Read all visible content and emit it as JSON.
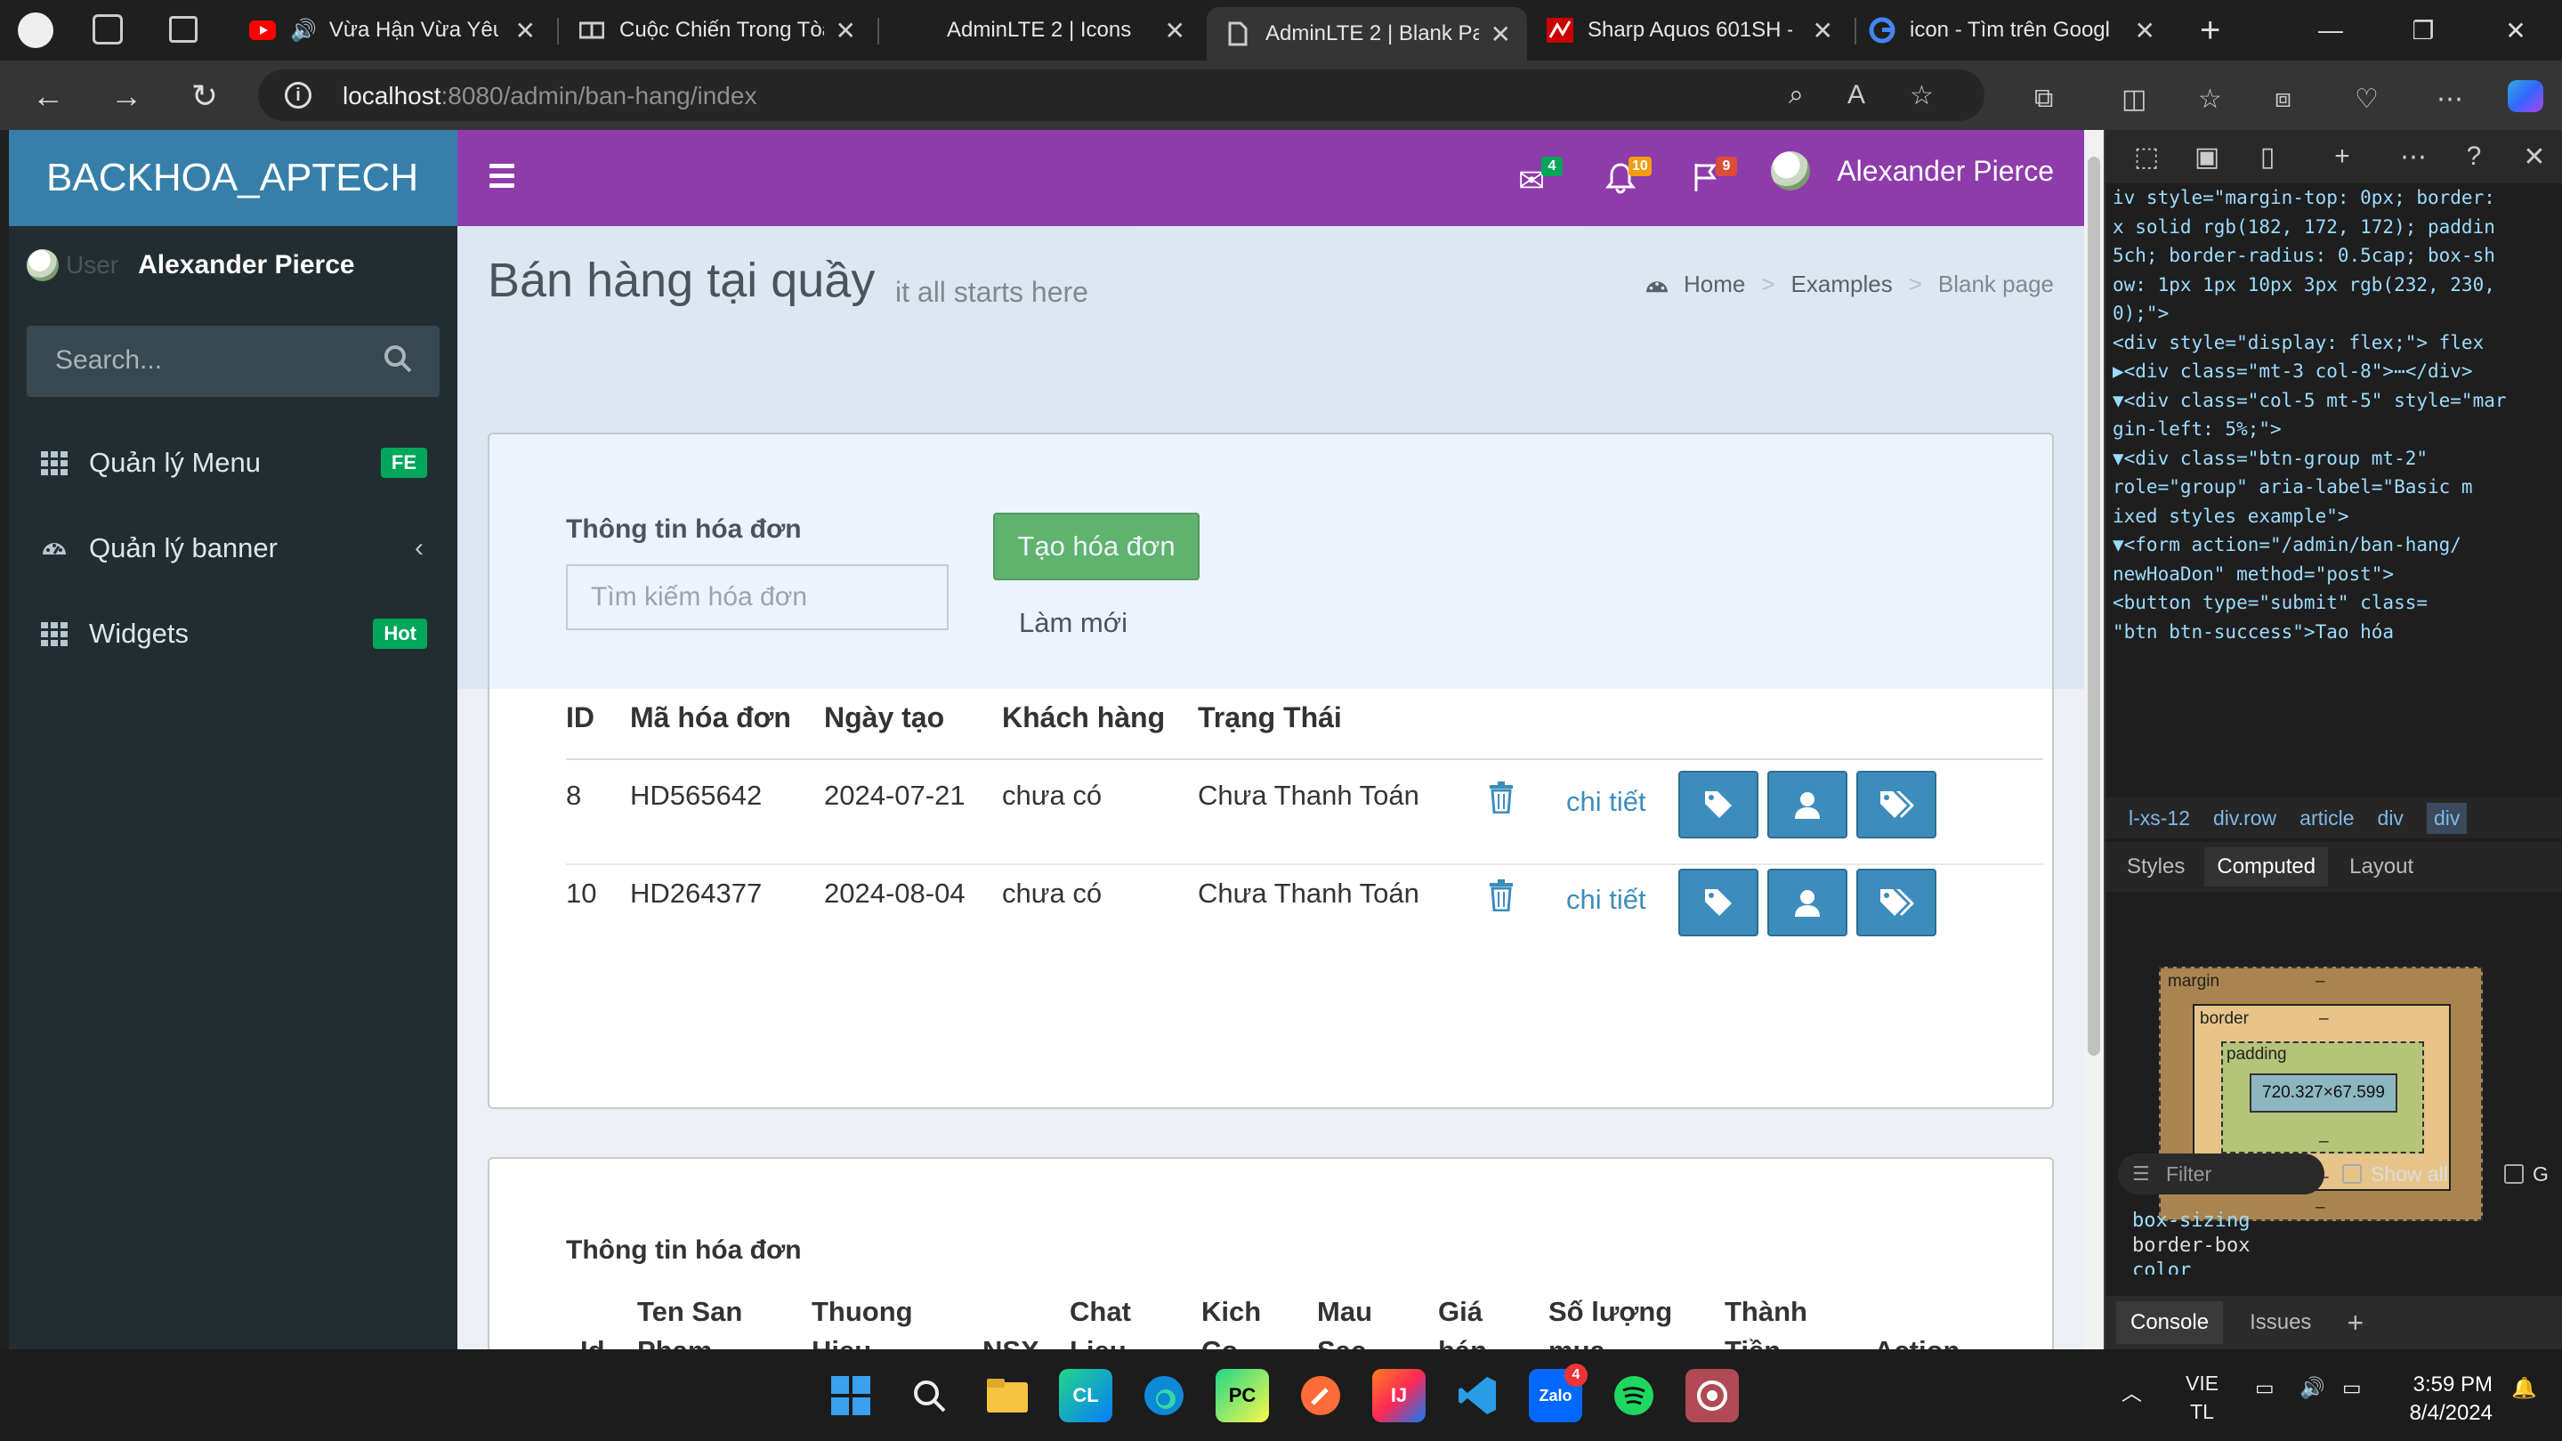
{
  "browser": {
    "tabs": [
      {
        "title": "Vừa Hận Vừa Yêu",
        "favicon": "youtube-icon"
      },
      {
        "title": "Cuộc Chiến Trong Tòa",
        "favicon": "book-icon"
      },
      {
        "title": "AdminLTE 2 | Icons",
        "favicon": "none"
      },
      {
        "title": "AdminLTE 2 | Blank Pa",
        "favicon": "page-icon"
      },
      {
        "title": "Sharp Aquos 601SH -",
        "favicon": "store-icon"
      },
      {
        "title": "icon - Tìm trên Googl",
        "favicon": "google-icon"
      }
    ],
    "url_host": "localhost",
    "url_path": ":8080/admin/ban-hang/index"
  },
  "app": {
    "logo": "BACKHOA_APTECH",
    "user_name": "Alexander Pierce",
    "notifications": {
      "messages": "4",
      "alerts": "10",
      "tasks": "9"
    }
  },
  "sidebar": {
    "user_name": "Alexander Pierce",
    "user_alt": "User",
    "search_placeholder": "Search...",
    "items": [
      {
        "label": "Quản lý Menu",
        "badge": "FE"
      },
      {
        "label": "Quản lý banner",
        "badge": ""
      },
      {
        "label": "Widgets",
        "badge": "Hot"
      }
    ]
  },
  "header": {
    "title": "Bán hàng tại quầy",
    "subtitle": "it all starts here",
    "breadcrumb": [
      "Home",
      "Examples",
      "Blank page"
    ]
  },
  "invoice_box": {
    "section_title": "Thông tin hóa đơn",
    "search_placeholder": "Tìm kiếm hóa đơn",
    "create_label": "Tạo hóa đơn",
    "refresh_label": "Làm mới",
    "columns": [
      "ID",
      "Mã hóa đơn",
      "Ngày tạo",
      "Khách hàng",
      "Trạng Thái"
    ],
    "detail_label": "chi tiết",
    "rows": [
      {
        "id": "8",
        "code": "HD565642",
        "date": "2024-07-21",
        "customer": "chưa có",
        "status": "Chưa Thanh Toán"
      },
      {
        "id": "10",
        "code": "HD264377",
        "date": "2024-08-04",
        "customer": "chưa có",
        "status": "Chưa Thanh Toán"
      }
    ]
  },
  "detail_box": {
    "section_title": "Thông tin hóa đơn",
    "columns": [
      {
        "l1": "",
        "l2": "Id"
      },
      {
        "l1": "Ten San",
        "l2": "Pham"
      },
      {
        "l1": "Thuong",
        "l2": "Hieu"
      },
      {
        "l1": "",
        "l2": "NSX"
      },
      {
        "l1": "Chat",
        "l2": "Lieu"
      },
      {
        "l1": "Kich",
        "l2": "Co"
      },
      {
        "l1": "Mau",
        "l2": "Sac"
      },
      {
        "l1": "Giá",
        "l2": "bán"
      },
      {
        "l1": "Số lượng",
        "l2": "mua"
      },
      {
        "l1": "Thành",
        "l2": "Tiền"
      },
      {
        "l1": "",
        "l2": "Action"
      }
    ]
  },
  "devtools": {
    "dom_lines": [
      "iv style=\"margin-top: 0px; border:",
      "x solid rgb(182, 172, 172); paddin",
      " 5ch; border-radius: 0.5cap; box-sh",
      "ow: 1px 1px 10px 3px rgb(232, 230,",
      "0);\">",
      "<div style=\"display: flex;\"> flex",
      "▶<div class=\"mt-3 col-8\">⋯</div>",
      "▼<div class=\"col-5 mt-5\" style=\"mar",
      "  gin-left: 5%;\">",
      "  ▼<div class=\"btn-group mt-2\"",
      "    role=\"group\" aria-label=\"Basic m",
      "    ixed styles example\">",
      "    ▼<form action=\"/admin/ban-hang/",
      "      newHoaDon\" method=\"post\">",
      "        <button type=\"submit\" class=",
      "        \"btn btn-success\">Tao hóa"
    ],
    "crumbs": [
      "l-xs-12",
      "div.row",
      "article",
      "div",
      "div"
    ],
    "subtabs": [
      "Styles",
      "Computed",
      "Layout"
    ],
    "boxmodel": {
      "margin": "margin",
      "border": "border",
      "padding": "padding",
      "content": "720.327×67.599",
      "dash": "–"
    },
    "filter_placeholder": "Filter",
    "show_all": "Show all",
    "g_label": "G",
    "props": [
      "box-sizing",
      "border-box",
      "color"
    ],
    "bottom_tabs": [
      "Console",
      "Issues"
    ]
  },
  "taskbar": {
    "lang1": "VIE",
    "lang2": "TL",
    "time": "3:59 PM",
    "date": "8/4/2024",
    "zalo_badge": "4"
  }
}
